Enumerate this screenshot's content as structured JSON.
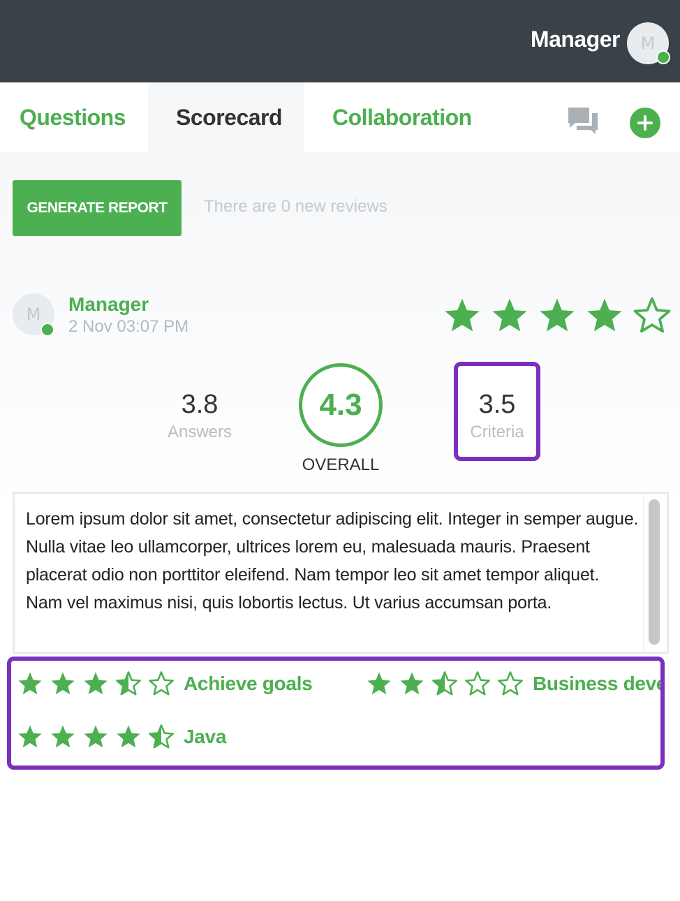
{
  "header": {
    "user_name": "Manager",
    "avatar_initial": "M"
  },
  "tabs": [
    {
      "label": "Questions",
      "active": false
    },
    {
      "label": "Scorecard",
      "active": true
    },
    {
      "label": "Collaboration",
      "active": false
    }
  ],
  "toolbar": {
    "generate_report_label": "GENERATE REPORT",
    "reviews_note": "There are 0 new reviews"
  },
  "review": {
    "author": "Manager",
    "avatar_initial": "M",
    "date": "2 Nov 03:07 PM",
    "rating": 4,
    "rating_max": 5,
    "comment": "Lorem ipsum dolor sit amet, consectetur adipiscing elit. Integer in semper augue. Nulla vitae leo ullamcorper, ultrices lorem eu, malesuada mauris. Praesent placerat odio non porttitor eleifend. Nam tempor leo sit amet tempor aliquet. Nam vel maximus nisi, quis lobortis lectus. Ut varius accumsan porta."
  },
  "scores": {
    "answers": {
      "value": "3.8",
      "label": "Answers"
    },
    "overall": {
      "value": "4.3",
      "label": "OVERALL"
    },
    "criteria": {
      "value": "3.5",
      "label": "Criteria"
    }
  },
  "criteria": [
    {
      "label": "Achieve goals",
      "rating": 3.5
    },
    {
      "label": "Business deve...",
      "rating": 2.5
    },
    {
      "label": "Java",
      "rating": 4.5
    }
  ],
  "colors": {
    "accent": "#4caf50",
    "header_bg": "#394249",
    "highlight": "#7b2fbf"
  },
  "icons": {
    "chat": "chat-bubbles-icon",
    "add": "add-circle-icon",
    "star_full": "star-icon",
    "star_half": "star-half-icon",
    "star_empty": "star-outline-icon"
  }
}
